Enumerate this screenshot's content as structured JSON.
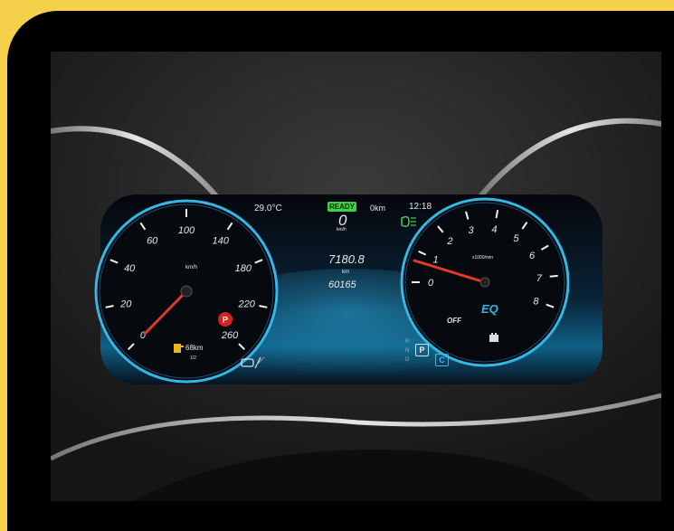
{
  "cluster": {
    "temperature": "29.0°C",
    "ready_badge": "READY",
    "range_top": "0km",
    "clock": "12:18",
    "digital_speed": "0",
    "digital_speed_unit": "km/h",
    "odometer_trip": "7180.8",
    "odometer_unit": "km",
    "odometer_total": "60165",
    "fuel_range": "68km",
    "fuel_fraction": "1/2",
    "gears": [
      "R",
      "N",
      "D"
    ],
    "gear_selected": "P",
    "drive_mode": "C"
  },
  "speedometer": {
    "unit": "km/h",
    "ticks": [
      "0",
      "20",
      "40",
      "60",
      "100",
      "140",
      "180",
      "220",
      "260"
    ],
    "needle_value": 0
  },
  "power_meter": {
    "unit": "x1000/min",
    "ticks": [
      "0",
      "1",
      "2",
      "3",
      "4",
      "5",
      "6",
      "7",
      "8"
    ],
    "off_label": "OFF",
    "brand_logo": "EQ",
    "needle_value": 1
  },
  "icons": [
    "parking-brake-icon",
    "fuel-pump-icon",
    "headlight-icon",
    "lane-assist-icon",
    "battery-icon"
  ],
  "colors": {
    "frame": "#f5d04a",
    "gauge_ring": "#35b7e6",
    "needle": "#e23a2a",
    "ready": "#3fd04a"
  }
}
